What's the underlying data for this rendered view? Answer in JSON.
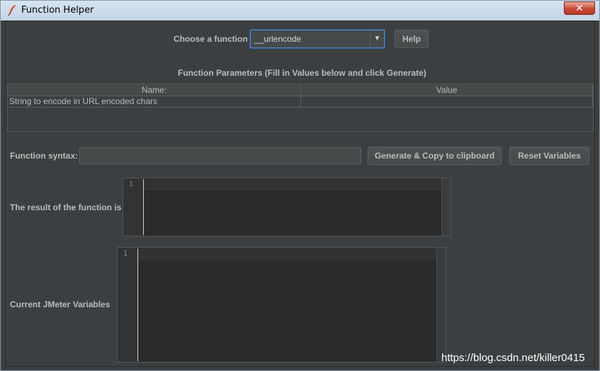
{
  "window": {
    "title": "Function Helper",
    "close_glyph": "✕"
  },
  "chooser": {
    "label": "Choose a function",
    "selected": "__urlencode",
    "arrow": "▼",
    "help_label": "Help"
  },
  "params": {
    "header": "Function Parameters (Fill in Values below and click Generate)",
    "columns": [
      "Name:",
      "Value"
    ],
    "rows": [
      {
        "name": "String to encode in URL encoded chars",
        "value": ""
      }
    ]
  },
  "syntax": {
    "label": "Function syntax:",
    "value": "",
    "generate_label": "Generate & Copy to clipboard",
    "reset_label": "Reset Variables"
  },
  "result": {
    "label": "The result of the function is",
    "line_number": "1"
  },
  "variables": {
    "label": "Current JMeter Variables",
    "line_number": "1"
  },
  "footer": {
    "url": "https://blog.csdn.net/killer0415"
  },
  "colors": {
    "background": "#3c3f41",
    "accent": "#4a88c7",
    "text": "#bbbbbb"
  },
  "icons": [
    "feather-icon",
    "close-icon",
    "chevron-down-icon"
  ]
}
